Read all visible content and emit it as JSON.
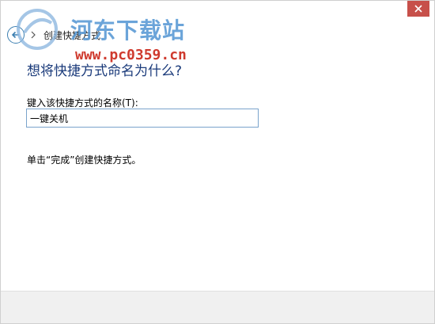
{
  "window": {
    "title": "创建快捷方式",
    "close_icon": "close-icon",
    "close_color": "#c7504a"
  },
  "watermark": {
    "site_name": "河东下载站",
    "url": "www.pc0359.cn"
  },
  "content": {
    "heading": "想将快捷方式命名为什么?",
    "field_label": "键入该快捷方式的名称(T):",
    "name_value": "一键关机",
    "hint": "单击“完成”创建快捷方式。"
  }
}
